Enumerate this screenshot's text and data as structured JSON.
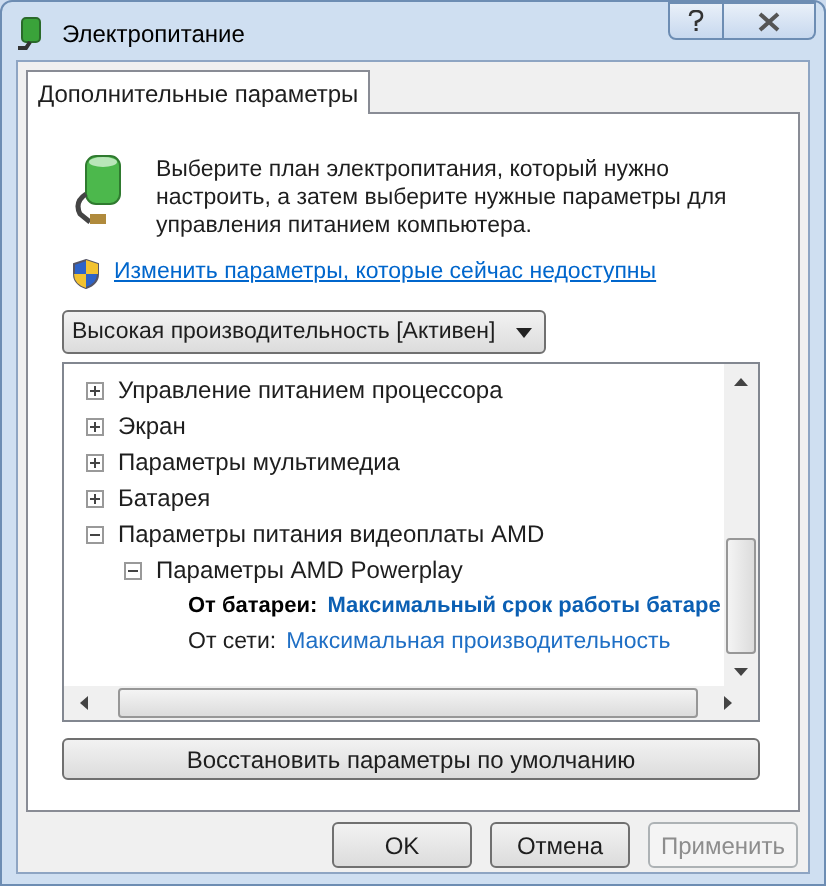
{
  "window": {
    "title": "Электропитание"
  },
  "tabs": [
    {
      "label": "Дополнительные параметры",
      "selected": true
    }
  ],
  "description": "Выберите план электропитания, который нужно настроить, а затем выберите нужные параметры для управления питанием компьютера.",
  "admin_link": "Изменить параметры, которые сейчас недоступны",
  "plan_dropdown": {
    "value": "Высокая производительность [Активен]"
  },
  "tree": [
    {
      "kind": "group",
      "label": "Управление питанием процессора",
      "expanded": false
    },
    {
      "kind": "group",
      "label": "Экран",
      "expanded": false
    },
    {
      "kind": "group",
      "label": "Параметры мультимедиа",
      "expanded": false
    },
    {
      "kind": "group",
      "label": "Батарея",
      "expanded": false
    },
    {
      "kind": "group",
      "label": "Параметры питания видеоплаты AMD",
      "expanded": true,
      "children": [
        {
          "kind": "group",
          "label": "Параметры AMD Powerplay",
          "expanded": true,
          "children": [
            {
              "kind": "setting",
              "label": "От батареи:",
              "value": "Максимальный срок работы батаре",
              "selected": true
            },
            {
              "kind": "setting",
              "label": "От сети:",
              "value": "Максимальная производительность",
              "selected": false
            }
          ]
        }
      ]
    }
  ],
  "restore_button": "Восстановить параметры по умолчанию",
  "buttons": [
    {
      "label": "OK",
      "disabled": false
    },
    {
      "label": "Отмена",
      "disabled": false
    },
    {
      "label": "Применить",
      "disabled": true
    }
  ]
}
